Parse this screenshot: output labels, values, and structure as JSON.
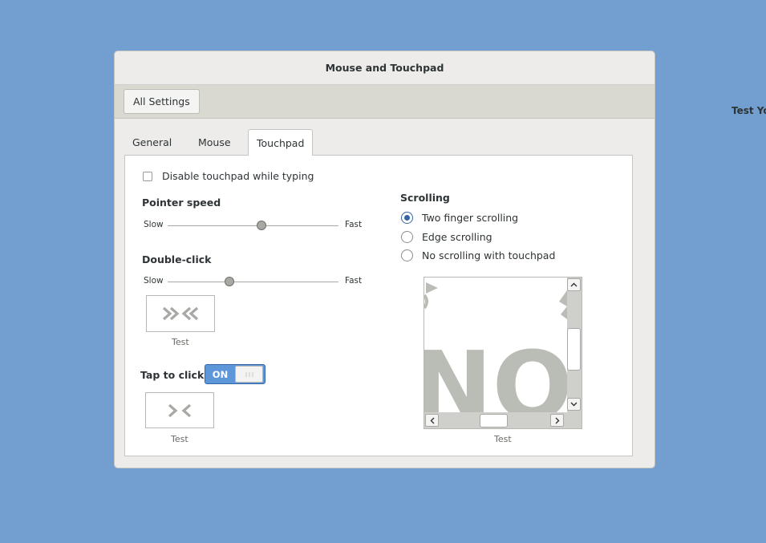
{
  "background_label": "Test Yo",
  "window": {
    "title": "Mouse and Touchpad",
    "all_settings_label": "All Settings"
  },
  "tabs": [
    {
      "label": "General",
      "active": false
    },
    {
      "label": "Mouse",
      "active": false
    },
    {
      "label": "Touchpad",
      "active": true
    }
  ],
  "touchpad": {
    "disable_while_typing": {
      "label": "Disable touchpad while typing",
      "checked": false
    },
    "pointer_speed": {
      "heading": "Pointer speed",
      "min_label": "Slow",
      "max_label": "Fast",
      "value": 0.55
    },
    "double_click": {
      "heading": "Double-click",
      "min_label": "Slow",
      "max_label": "Fast",
      "value": 0.36,
      "test_label": "Test"
    },
    "tap_to_click": {
      "heading": "Tap to click",
      "state_label": "ON",
      "enabled": true,
      "test_label": "Test"
    },
    "scrolling": {
      "heading": "Scrolling",
      "options": [
        {
          "label": "Two finger scrolling",
          "selected": true
        },
        {
          "label": "Edge scrolling",
          "selected": false
        },
        {
          "label": "No scrolling with touchpad",
          "selected": false
        }
      ],
      "test_label": "Test",
      "preview_text": "NOM"
    }
  },
  "colors": {
    "desktop": "#729fcf",
    "accent": "#3465a4",
    "switch_on": "#5d97d9",
    "preview_glyph": "#babdb6"
  }
}
